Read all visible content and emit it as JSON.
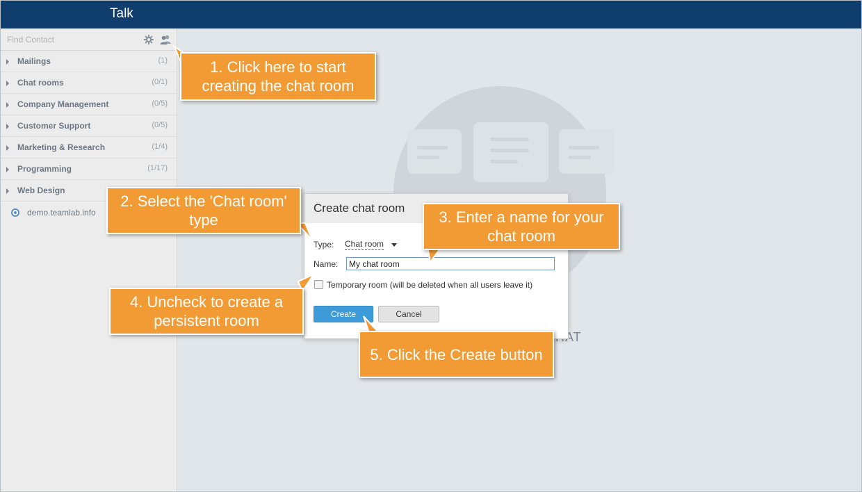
{
  "app": {
    "title": "Talk"
  },
  "sidebar": {
    "search_placeholder": "Find Contact",
    "groups": [
      {
        "label": "Mailings",
        "count": "(1)"
      },
      {
        "label": "Chat rooms",
        "count": "(0/1)"
      },
      {
        "label": "Company Management",
        "count": "(0/5)"
      },
      {
        "label": "Customer Support",
        "count": "(0/5)"
      },
      {
        "label": "Marketing & Research",
        "count": "(1/4)"
      },
      {
        "label": "Programming",
        "count": "(1/17)"
      },
      {
        "label": "Web Design",
        "count": ""
      }
    ],
    "account": "demo.teamlab.info"
  },
  "background": {
    "word": "CHAT"
  },
  "dialog": {
    "title": "Create chat room",
    "type_label": "Type:",
    "type_value": "Chat room",
    "name_label": "Name:",
    "name_value": "My chat room",
    "temporary_label": "Temporary room (will be deleted when all users leave it)",
    "temporary_checked": false,
    "create_label": "Create",
    "cancel_label": "Cancel"
  },
  "callouts": {
    "step1": "1. Click here to start creating the chat room",
    "step2": "2. Select the 'Chat room' type",
    "step3": "3. Enter a name for your chat room",
    "step4": "4. Uncheck to create a persistent room",
    "step5": "5. Click the Create button"
  },
  "colors": {
    "topbar": "#0f3d6e",
    "callout": "#f29a33",
    "primary_button": "#3c9bd8"
  }
}
